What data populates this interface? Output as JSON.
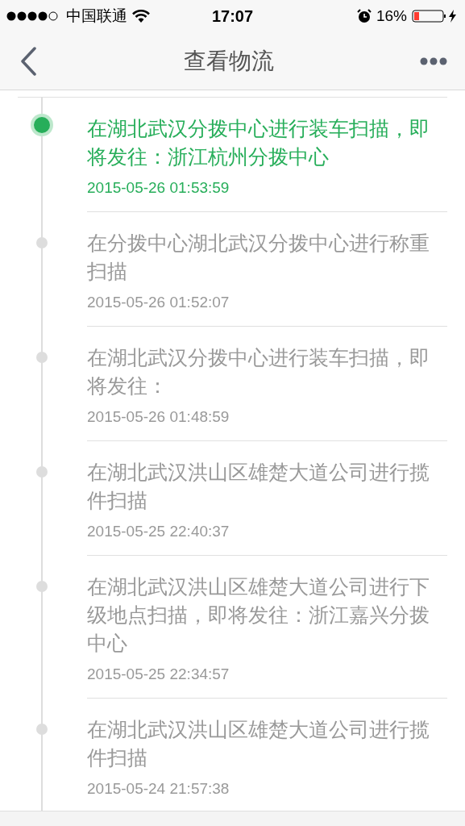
{
  "status_bar": {
    "carrier": "中国联通",
    "time": "17:07",
    "battery": "16%"
  },
  "nav_bar": {
    "title": "查看物流"
  },
  "events": [
    {
      "description": "在湖北武汉分拨中心进行装车扫描，即将发往：浙江杭州分拨中心",
      "time": "2015-05-26 01:53:59",
      "current": true
    },
    {
      "description": "在分拨中心湖北武汉分拨中心进行称重扫描",
      "time": "2015-05-26 01:52:07",
      "current": false
    },
    {
      "description": "在湖北武汉分拨中心进行装车扫描，即将发往：",
      "time": "2015-05-26 01:48:59",
      "current": false
    },
    {
      "description": "在湖北武汉洪山区雄楚大道公司进行揽件扫描",
      "time": "2015-05-25 22:40:37",
      "current": false
    },
    {
      "description": "在湖北武汉洪山区雄楚大道公司进行下级地点扫描，即将发往：浙江嘉兴分拨中心",
      "time": "2015-05-25 22:34:57",
      "current": false
    },
    {
      "description": "在湖北武汉洪山区雄楚大道公司进行揽件扫描",
      "time": "2015-05-24 21:57:38",
      "current": false
    }
  ]
}
